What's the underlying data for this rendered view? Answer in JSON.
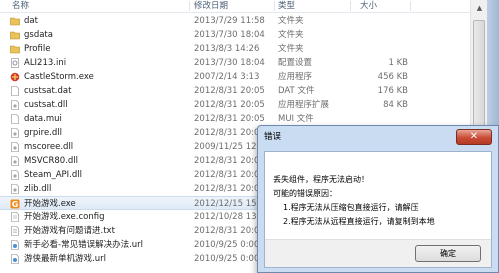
{
  "header": {
    "name": "名称",
    "date": "修改日期",
    "type": "类型",
    "size": "大小"
  },
  "files": [
    {
      "name": "dat",
      "date": "2013/7/29 11:58",
      "type": "文件夹",
      "size": "",
      "icon": "folder-icon"
    },
    {
      "name": "gsdata",
      "date": "2013/7/30 18:04",
      "type": "文件夹",
      "size": "",
      "icon": "folder-icon"
    },
    {
      "name": "Profile",
      "date": "2013/8/3 14:26",
      "type": "文件夹",
      "size": "",
      "icon": "folder-icon"
    },
    {
      "name": "ALI213.ini",
      "date": "2013/7/30 18:04",
      "type": "配置设置",
      "size": "1 KB",
      "icon": "ini-file-icon"
    },
    {
      "name": "CastleStorm.exe",
      "date": "2007/2/14 3:13",
      "type": "应用程序",
      "size": "456 KB",
      "icon": "exe-icon"
    },
    {
      "name": "custsat.dat",
      "date": "2012/8/31 20:05",
      "type": "DAT 文件",
      "size": "176 KB",
      "icon": "file-icon"
    },
    {
      "name": "custsat.dll",
      "date": "2012/8/31 20:05",
      "type": "应用程序扩展",
      "size": "84 KB",
      "icon": "dll-icon"
    },
    {
      "name": "data.mui",
      "date": "2012/8/31 20:05",
      "type": "MUI 文件",
      "size": "",
      "icon": "file-icon"
    },
    {
      "name": "grpire.dll",
      "date": "2012/8/31 20:05",
      "type": "",
      "size": "",
      "icon": "dll-icon"
    },
    {
      "name": "mscoree.dll",
      "date": "2009/11/25 12:54",
      "type": "",
      "size": "",
      "icon": "dll-icon"
    },
    {
      "name": "MSVCR80.dll",
      "date": "2012/8/31 20:05",
      "type": "",
      "size": "",
      "icon": "dll-icon"
    },
    {
      "name": "Steam_API.dll",
      "date": "2012/8/31 20:05",
      "type": "",
      "size": "",
      "icon": "dll-icon"
    },
    {
      "name": "zlib.dll",
      "date": "2012/8/31 20:05",
      "type": "",
      "size": "",
      "icon": "dll-icon"
    },
    {
      "name": "开始游戏.exe",
      "date": "2012/12/15 15:18",
      "type": "",
      "size": "",
      "icon": "game-exe-icon",
      "selected": true
    },
    {
      "name": "开始游戏.exe.config",
      "date": "2012/10/28 13:29",
      "type": "",
      "size": "",
      "icon": "config-file-icon"
    },
    {
      "name": "开始游戏有问题请进.txt",
      "date": "2012/8/31 20:05",
      "type": "",
      "size": "",
      "icon": "text-file-icon"
    },
    {
      "name": "新手必看-常见错误解决办法.url",
      "date": "2010/9/25 0:00",
      "type": "",
      "size": "",
      "icon": "url-file-icon"
    },
    {
      "name": "游侠最新单机游戏.url",
      "date": "2010/9/25 0:00",
      "type": "",
      "size": "",
      "icon": "url-file-icon"
    }
  ],
  "dialog": {
    "title": "错误",
    "close": "✕",
    "line1": "丢失组件，程序无法启动！",
    "line2": "可能的错误原因：",
    "line3": "1.程序无法从压缩包直接运行，请解压",
    "line4": "2.程序无法从远程直接运行，请复制到本地",
    "ok": "确定"
  }
}
